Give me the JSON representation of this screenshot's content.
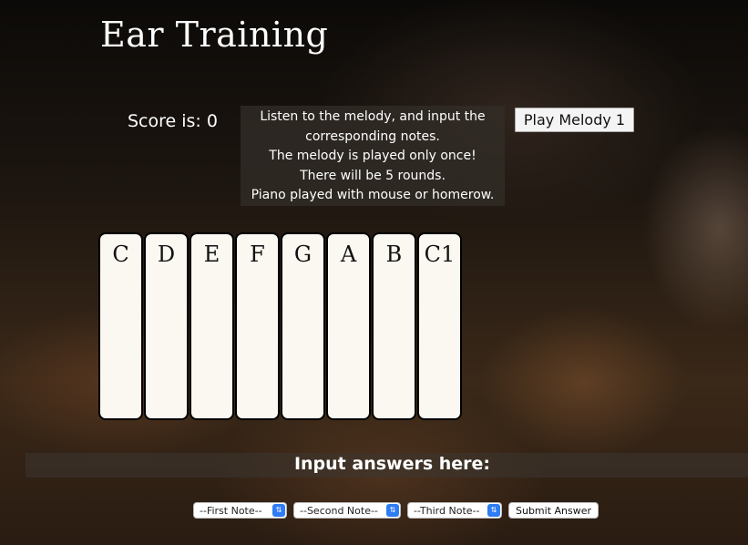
{
  "header": {
    "title": "Ear Training"
  },
  "score": {
    "label": "Score is: 0"
  },
  "instructions": {
    "lines": [
      "Listen to the melody, and input the",
      "corresponding notes.",
      "The melody is played only once!",
      "There will be 5 rounds.",
      "Piano played with mouse or homerow."
    ]
  },
  "play_button": {
    "label": "Play Melody 1"
  },
  "piano": {
    "keys": [
      "C",
      "D",
      "E",
      "F",
      "G",
      "A",
      "B",
      "C1"
    ]
  },
  "answers": {
    "heading": "Input answers here:",
    "selects": [
      "--First Note--",
      "--Second Note--",
      "--Third Note--"
    ],
    "submit_label": "Submit Answer"
  },
  "icons": {
    "select_arrows": "up-down-chevron-icon"
  }
}
